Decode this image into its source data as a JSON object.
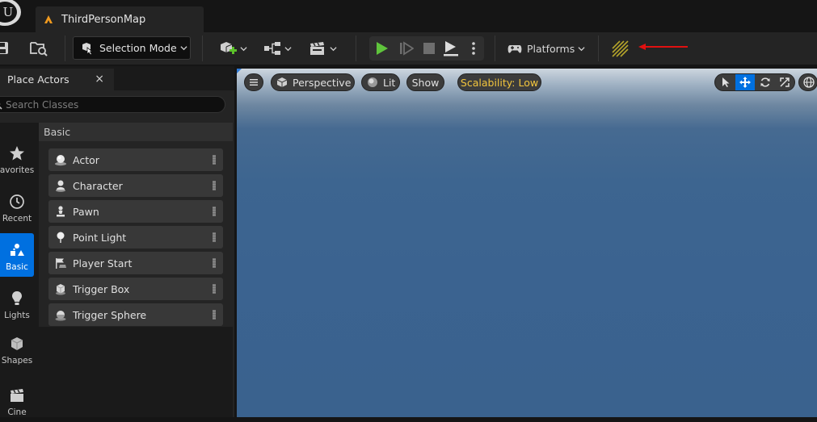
{
  "app": {
    "document_tab": "ThirdPersonMap"
  },
  "toolbar": {
    "selection_mode": "Selection Mode",
    "platforms": "Platforms"
  },
  "annotation": {
    "arrow_color": "#e01010"
  },
  "place_actors": {
    "tab_label": "Place Actors",
    "close_glyph": "×",
    "search_placeholder": "Search Classes",
    "categories": [
      {
        "label": "avorites",
        "icon": "star-icon"
      },
      {
        "label": "Recent",
        "icon": "clock-icon"
      },
      {
        "label": "Basic",
        "icon": "basic-shapes-icon",
        "active": true
      },
      {
        "label": "Lights",
        "icon": "lightbulb-icon"
      },
      {
        "label": "Shapes",
        "icon": "cube-icon"
      },
      {
        "label": "Cine",
        "icon": "clapperboard-icon"
      }
    ],
    "section_header": "Basic",
    "actors": [
      {
        "label": "Actor",
        "icon": "actor-sphere-icon"
      },
      {
        "label": "Character",
        "icon": "character-icon"
      },
      {
        "label": "Pawn",
        "icon": "pawn-icon"
      },
      {
        "label": "Point Light",
        "icon": "point-light-icon"
      },
      {
        "label": "Player Start",
        "icon": "player-start-icon"
      },
      {
        "label": "Trigger Box",
        "icon": "trigger-box-icon"
      },
      {
        "label": "Trigger Sphere",
        "icon": "trigger-sphere-icon"
      }
    ]
  },
  "viewport": {
    "perspective": "Perspective",
    "lit": "Lit",
    "show": "Show",
    "scalability": "Scalability: Low",
    "colors": {
      "accent": "#0070e0",
      "scalability_text": "#f2c53d",
      "sky": "#3b6390"
    }
  }
}
